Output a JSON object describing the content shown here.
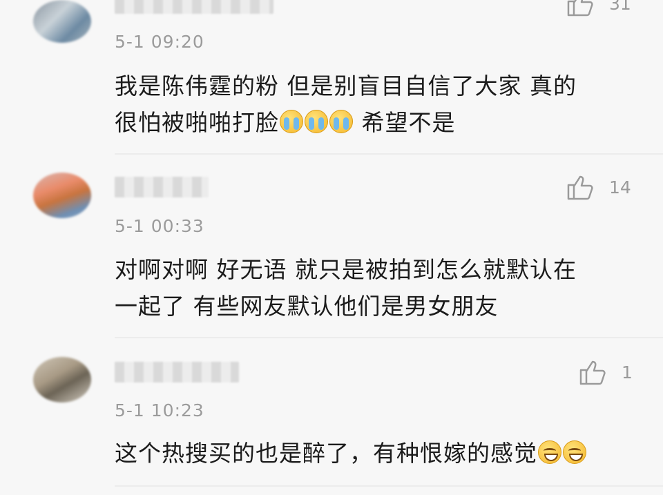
{
  "comments": [
    {
      "time": "5-1 09:20",
      "like_count": "31",
      "text_line1": "我是陈伟霆的粉 但是别盲目自信了大家 真的",
      "text_line2_before": "很怕被啪啪打脸",
      "emoji_name": "crying-emoji",
      "text_line2_after": " 希望不是"
    },
    {
      "time": "5-1 00:33",
      "like_count": "14",
      "text_line1": "对啊对啊 好无语 就只是被拍到怎么就默认在",
      "text_line2": "一起了 有些网友默认他们是男女朋友"
    },
    {
      "time": "5-1 10:23",
      "like_count": "1",
      "text_line1": "这个热搜买的也是醉了，有种恨嫁的感觉",
      "emoji_name": "grinning-emoji"
    }
  ],
  "colors": {
    "background": "#f7f7f7",
    "time_text": "#9b9b9b",
    "like_icon": "#9a9a9a",
    "body_text": "#1b1b1b"
  }
}
